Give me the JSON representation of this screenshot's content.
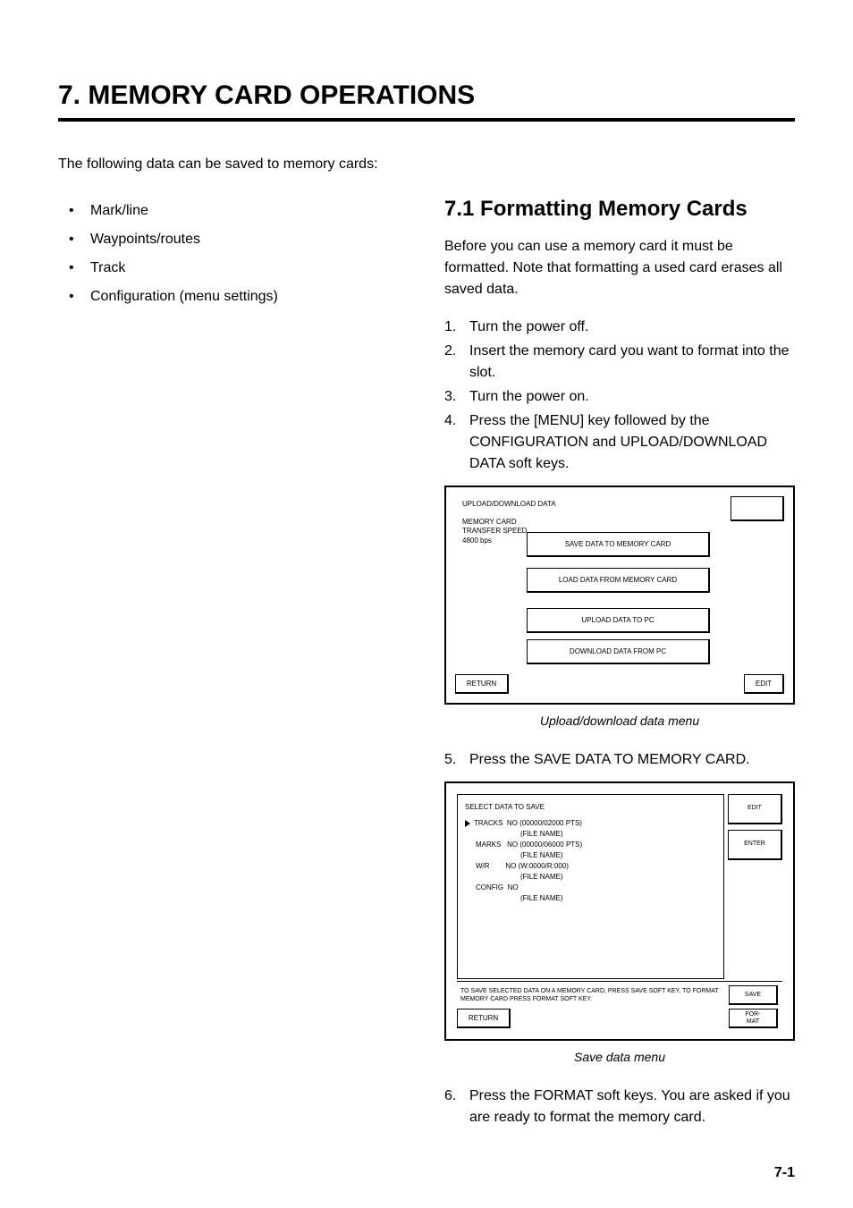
{
  "chapter": "7.  MEMORY CARD OPERATIONS",
  "intro": "The following data can be saved to memory cards:",
  "bullets": [
    "Mark/line",
    "Waypoints/routes",
    "Track",
    "Configuration (menu settings)"
  ],
  "right": {
    "sectionTitle": "7.1 Formatting Memory Cards",
    "sectionText": "Before you can use a memory card it must be formatted. Note that formatting a used card erases all saved data.",
    "steps": [
      {
        "num": "1.",
        "body": "Turn the power off."
      },
      {
        "num": "2.",
        "body": "Insert the memory card you want to format into the slot."
      },
      {
        "num": "3.",
        "body": "Turn the power on."
      },
      {
        "num": "4.",
        "body": "Press the [MENU] key followed by the CONFIGURATION and UPLOAD/DOWNLOAD DATA soft keys."
      }
    ],
    "diagram1": {
      "title": "UPLOAD/DOWNLOAD DATA",
      "line1": "MEMORY CARD",
      "line2": "TRANSFER SPEED",
      "line3": "4800 bps",
      "btn1": "SAVE DATA TO MEMORY CARD",
      "btn2": "LOAD DATA FROM MEMORY CARD",
      "btn3": "UPLOAD DATA TO PC",
      "btn4": "DOWNLOAD DATA FROM PC",
      "return": "RETURN",
      "edit": "EDIT",
      "caption": "Upload/download data menu"
    },
    "step5": {
      "num": "5.",
      "body": "Press the SAVE DATA TO MEMORY CARD."
    },
    "diagram2": {
      "title": "SELECT DATA TO SAVE",
      "r1a": "TRACKS",
      "r1b": "NO (00000/02000 PTS)",
      "r2b": "(FILE NAME)",
      "r3a": "MARKS",
      "r3b": "NO (00000/06000 PTS)",
      "r4b": "(FILE NAME)",
      "r5a": "W/R",
      "r5b": "NO (W:0000/R:000)",
      "r6b": "(FILE NAME)",
      "r7a": "CONFIG",
      "r7b": "NO",
      "r8b": "(FILE NAME)",
      "skEdit": "EDIT",
      "skEnter": "ENTER",
      "skSave": "SAVE",
      "skFormat": "FOR-\nMAT",
      "bottomText": "TO SAVE SELECTED DATA ON A MEMORY CARD, PRESS SAVE SOFT KEY. TO FORMAT MEMORY CARD PRESS FORMAT SOFT KEY.",
      "return": "RETURN",
      "caption": "Save data menu"
    },
    "step6": {
      "num": "6.",
      "body": "Press the FORMAT soft keys. You are asked if you are ready to format the memory card."
    }
  },
  "pageNum": "7-1"
}
